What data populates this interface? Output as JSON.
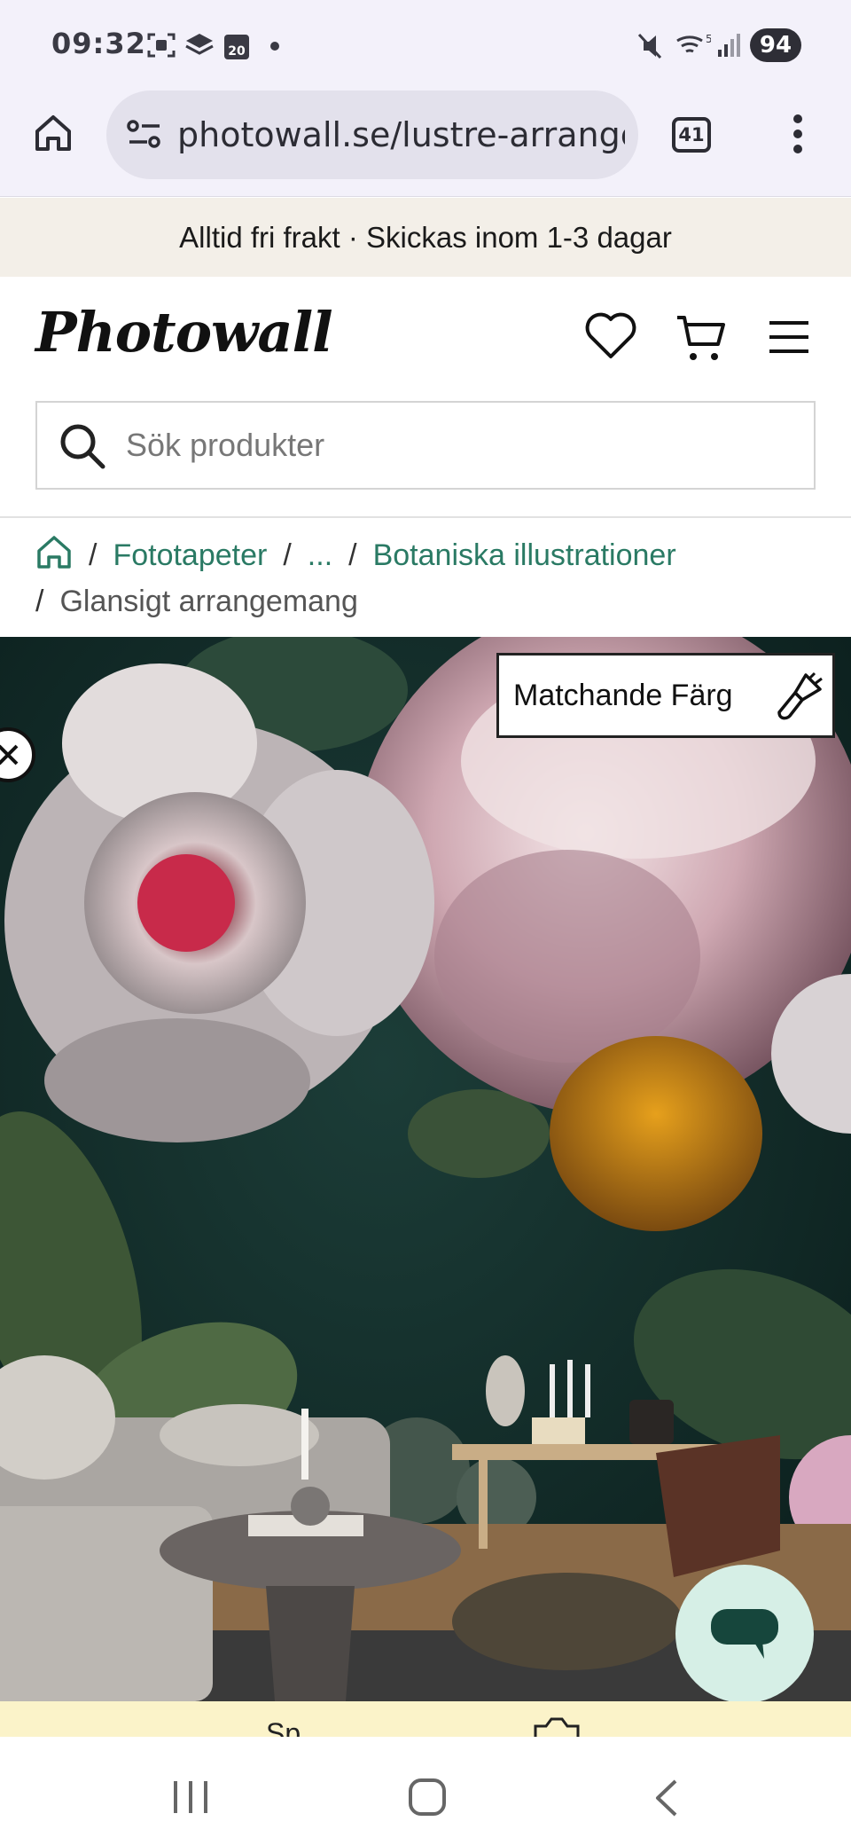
{
  "status_bar": {
    "time": "09:32",
    "calendar_day": "20",
    "battery": "94",
    "network": "5"
  },
  "browser": {
    "url": "photowall.se/lustre-arrange",
    "tab_count": "41"
  },
  "promo": {
    "text": "Alltid fri frakt · Skickas inom 1-3 dagar"
  },
  "header": {
    "logo_text": "Photowall",
    "search_placeholder": "Sök produkter"
  },
  "breadcrumb": {
    "items": [
      "Fototapeter",
      "...",
      "Botaniska illustrationer"
    ],
    "current": "Glansigt arrangemang"
  },
  "hero": {
    "match_color_label": "Matchande Färg"
  },
  "sticky_bar": {
    "text": "Sp..."
  },
  "colors": {
    "accent": "#2a7a64",
    "promo_bg": "#f3efe8",
    "chat_bg": "#d6efe6",
    "wall_dark": "#163430"
  }
}
